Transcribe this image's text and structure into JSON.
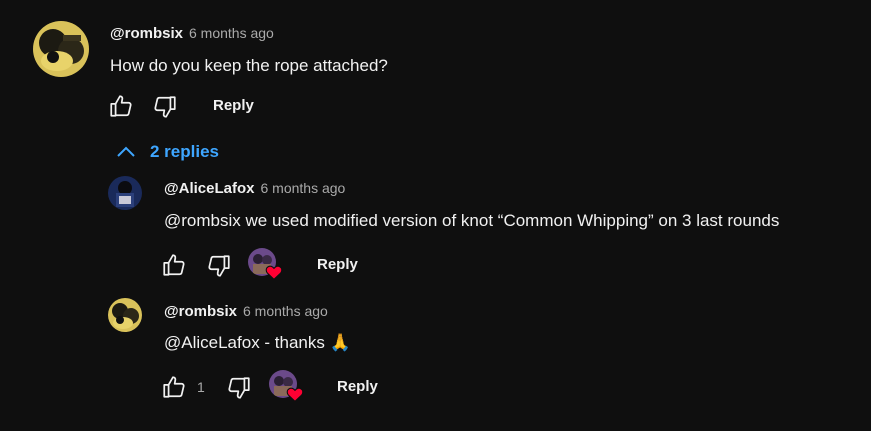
{
  "comments": [
    {
      "author": "@rombsix",
      "time": "6 months ago",
      "text": "How do you keep the rope attached?",
      "reply_label": "Reply"
    }
  ],
  "replies_toggle": {
    "label": "2 replies"
  },
  "replies": [
    {
      "author": "@AliceLafox",
      "time": "6 months ago",
      "text": "@rombsix we used modified version of knot “Common Whipping” on 3 last rounds",
      "reply_label": "Reply",
      "like_count": ""
    },
    {
      "author": "@rombsix",
      "time": "6 months ago",
      "text": "@AliceLafox  - thanks 🙏",
      "reply_label": "Reply",
      "like_count": "1"
    }
  ],
  "colors": {
    "background": "#0f0f0f",
    "link_blue": "#3ea6ff",
    "heart_red": "#ff0033",
    "secondary_text": "#aaaaaa"
  },
  "icons": [
    "thumbs-up-icon",
    "thumbs-down-icon",
    "chevron-up-icon",
    "creator-heart-icon"
  ]
}
